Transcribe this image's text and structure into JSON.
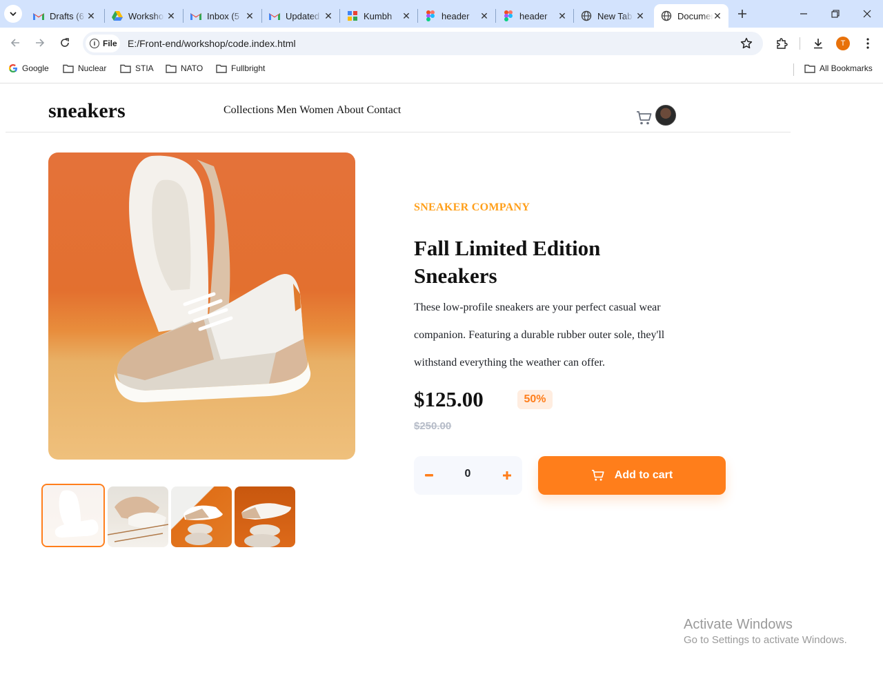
{
  "browser": {
    "tabs": [
      {
        "title": "Drafts (6",
        "icon": "gmail-icon"
      },
      {
        "title": "Workshop",
        "icon": "google-drive-icon"
      },
      {
        "title": "Inbox (5",
        "icon": "gmail-icon"
      },
      {
        "title": "Updated",
        "icon": "gmail-icon"
      },
      {
        "title": "Kumbh",
        "icon": "app-icon"
      },
      {
        "title": "header",
        "icon": "figma-icon"
      },
      {
        "title": "header",
        "icon": "figma-icon"
      },
      {
        "title": "New Tab",
        "icon": "globe-icon"
      },
      {
        "title": "Document",
        "icon": "globe-icon",
        "active": true
      }
    ],
    "site_chip": "File",
    "url": "E:/Front-end/workshop/code.index.html",
    "profile_initial": "T",
    "bookmarks": [
      "Google",
      "Nuclear",
      "STIA",
      "NATO",
      "Fullbright"
    ],
    "all_bookmarks": "All Bookmarks"
  },
  "page": {
    "brand": "sneakers",
    "nav": [
      "Collections",
      "Men",
      "Women",
      "About",
      "Contact"
    ],
    "company": "SNEAKER COMPANY",
    "title": "Fall Limited Edition Sneakers",
    "description": "These low-profile sneakers are your perfect casual wear companion. Featuring a durable rubber outer sole, they'll withstand everything the weather can offer.",
    "price": "$125.00",
    "discount": "50%",
    "old_price": "$250.00",
    "quantity": "0",
    "add_to_cart": "Add to cart"
  },
  "overlay": {
    "line1": "Activate Windows",
    "line2": "Go to Settings to activate Windows."
  },
  "colors": {
    "accent": "#ff7e1b",
    "company": "#ff9f1a",
    "chrome_tabstrip": "#d3e3fd"
  }
}
